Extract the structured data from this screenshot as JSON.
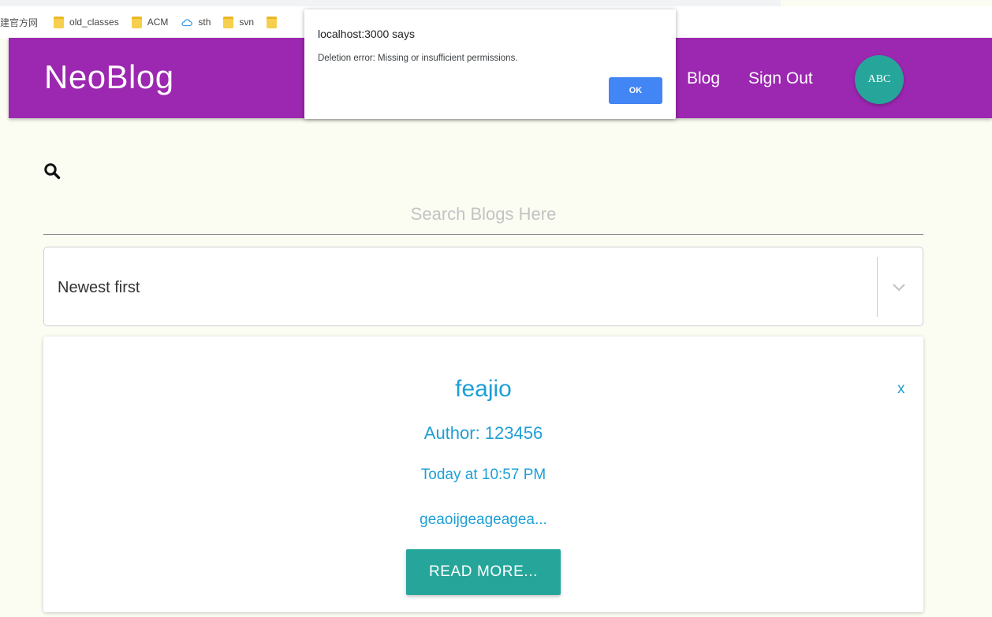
{
  "bookmarks": {
    "items": [
      {
        "label": "建官方网",
        "icon": "none"
      },
      {
        "label": "old_classes",
        "icon": "folder-icon"
      },
      {
        "label": "ACM",
        "icon": "folder-icon"
      },
      {
        "label": "sth",
        "icon": "cloud-icon"
      },
      {
        "label": "svn",
        "icon": "folder-icon"
      }
    ]
  },
  "header": {
    "brand": "NeoBlog",
    "nav_blog": "Blog",
    "nav_signout": "Sign Out",
    "avatar_initials": "ABC",
    "colors": {
      "bar": "#9c27b0",
      "avatar": "#26a69a"
    }
  },
  "search": {
    "placeholder": "Search Blogs Here",
    "value": ""
  },
  "sort": {
    "selected": "Newest first"
  },
  "blog": {
    "title": "feajio",
    "author": "Author: 123456",
    "date": "Today at 10:57 PM",
    "excerpt": "geaoijgeageagea...",
    "read_more": "READ MORE...",
    "delete_label": "x",
    "link_color": "#1e9fd6"
  },
  "alert": {
    "title": "localhost:3000 says",
    "message": "Deletion error: Missing or insufficient permissions.",
    "ok": "OK",
    "button_color": "#4285f4"
  }
}
